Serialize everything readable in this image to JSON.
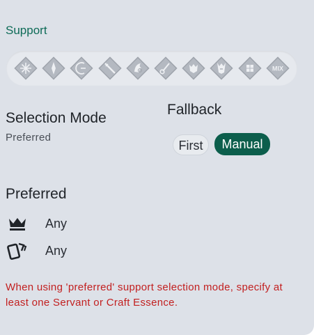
{
  "support": {
    "title": "Support",
    "class_icons": [
      "saber-icon",
      "archer-icon",
      "lancer-icon",
      "rider-icon",
      "caster-icon",
      "assassin-icon",
      "berserker-icon",
      "extra-icon",
      "all-icon",
      "mix-icon"
    ],
    "mix_label": "MIX"
  },
  "selection_mode": {
    "label": "Selection Mode",
    "value": "Preferred"
  },
  "fallback": {
    "label": "Fallback",
    "options": [
      "First",
      "Manual"
    ],
    "selected": "Manual"
  },
  "preferred": {
    "title": "Preferred",
    "servant": {
      "icon": "crown-icon",
      "value": "Any"
    },
    "craft_essence": {
      "icon": "cards-icon",
      "value": "Any"
    }
  },
  "warning": "When using 'preferred' support selection mode, specify at least one Servant or Craft Essence.",
  "colors": {
    "accent": "#0c5e4c",
    "title": "#0e6b57",
    "warning": "#c21f1f",
    "background": "#dde1e8"
  }
}
